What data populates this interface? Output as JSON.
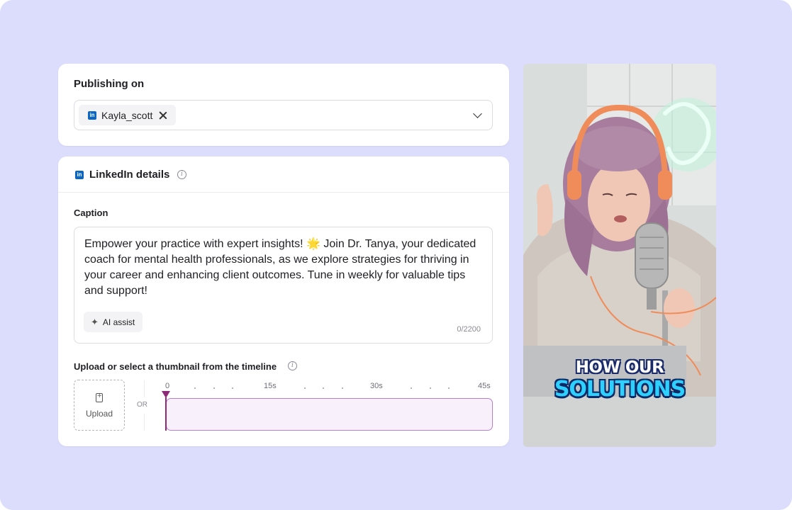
{
  "publishing": {
    "title": "Publishing on",
    "selected_account": "Kayla_scott",
    "network_icon": "linkedin-icon"
  },
  "linkedin": {
    "title": "LinkedIn details",
    "caption_label": "Caption",
    "caption_text": "Empower your practice with expert insights! 🌟 Join Dr. Tanya, your dedicated coach for mental health professionals, as we explore strategies for thriving in your career and enhancing client outcomes. Tune in weekly for valuable tips and support!",
    "ai_assist_label": "AI assist",
    "char_count": "0/2200",
    "thumbnail_label": "Upload or select a thumbnail from the timeline",
    "upload_label": "Upload",
    "or_label": "OR",
    "timeline_ticks": [
      "0",
      "15s",
      "30s",
      "45s"
    ]
  },
  "preview": {
    "caption_line1": "HOW OUR",
    "caption_line2": "SOLUTIONS"
  },
  "colors": {
    "background": "#dcdcfc",
    "linkedin_blue": "#0a66c2",
    "playhead": "#8e2a78",
    "timeline_border": "#b77fd1"
  }
}
